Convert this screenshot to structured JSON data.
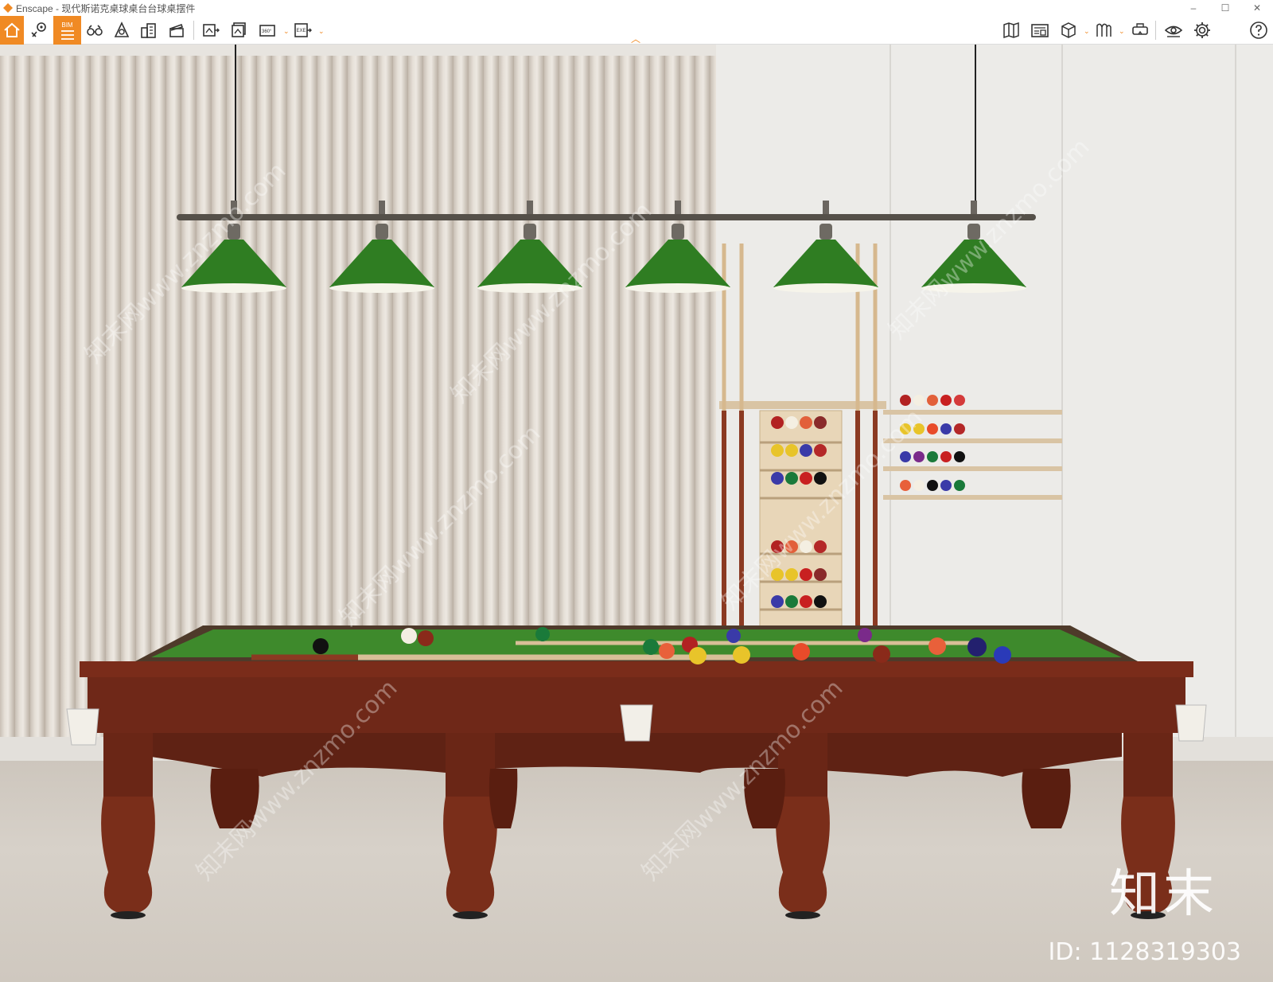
{
  "window": {
    "title": "Enscape - 现代斯诺克桌球桌台台球桌摆件",
    "controls": {
      "minimize": "–",
      "maximize": "☐",
      "close": "✕"
    }
  },
  "toolbar": {
    "left_buttons": [
      {
        "name": "home-button",
        "icon": "home-icon",
        "active": true
      },
      {
        "name": "navigation-button",
        "icon": "location-pin-icon"
      },
      {
        "name": "bim-button",
        "icon": "bim-icon",
        "label": "BIM",
        "active": true
      },
      {
        "name": "binoculars-button",
        "icon": "binoculars-icon"
      },
      {
        "name": "atmosphere-button",
        "icon": "atmosphere-icon"
      },
      {
        "name": "buildings-button",
        "icon": "buildings-icon"
      },
      {
        "name": "clapper-button",
        "icon": "clapper-icon"
      },
      {
        "name": "screenshot-button",
        "icon": "screenshot-icon"
      },
      {
        "name": "batch-render-button",
        "icon": "batch-render-icon"
      },
      {
        "name": "panorama-button",
        "icon": "panorama-icon",
        "label": "360°"
      },
      {
        "name": "export-button",
        "icon": "export-exe-icon",
        "label": "EXE"
      }
    ],
    "right_buttons": [
      {
        "name": "map-button",
        "icon": "map-icon"
      },
      {
        "name": "asset-library-button",
        "icon": "asset-library-icon"
      },
      {
        "name": "cube-button",
        "icon": "cube-icon"
      },
      {
        "name": "material-button",
        "icon": "material-icon"
      },
      {
        "name": "vr-button",
        "icon": "vr-headset-icon"
      },
      {
        "name": "visual-settings-button",
        "icon": "eye-icon"
      },
      {
        "name": "settings-button",
        "icon": "gear-icon"
      },
      {
        "name": "help-button",
        "icon": "help-icon"
      }
    ],
    "accent_color": "#f08a24"
  },
  "scene": {
    "watermark_text": "知末网www.znzmo.com",
    "logo_text": "知末",
    "id_text": "ID: 1128319303"
  },
  "colors": {
    "felt": "#3e8a2c",
    "wood": "#6f2818",
    "lamp_shade": "#2f7d22"
  }
}
